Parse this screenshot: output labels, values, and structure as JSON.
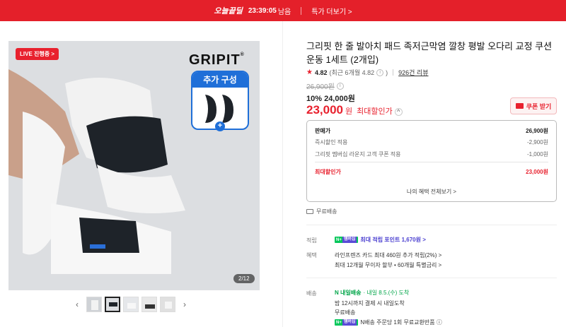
{
  "banner": {
    "brand": "오늘끝딜",
    "timer": "23:39:05",
    "remain": "남음",
    "more": "특가 더보기 >"
  },
  "gallery": {
    "live_badge": "LIVE 진행중 >",
    "brand_logo": "GRIPIT",
    "add_card_title": "추가 구성",
    "page_indicator": "2/12"
  },
  "product": {
    "title": "그리핏 한 줄 발아치 패드 족저근막염 깔창 평발 오다리 교정 쿠션 운동 1세트 (2개입)",
    "rating_score": "4.82",
    "rating_detail": "(최근 6개월 4.82",
    "rating_close": ")",
    "reviews": "926건 리뷰",
    "original_price": "26,900원",
    "discount_line": "10% 24,000원",
    "final_price": "23,000",
    "final_unit": "원",
    "final_label": "최대할인가",
    "coupon_button": "쿠폰 받기"
  },
  "price_box": {
    "rows": [
      {
        "label": "판매가",
        "value": "26,900원"
      },
      {
        "label": "즉시할인 적용",
        "value": "-2,900원"
      },
      {
        "label": "그리핏 멤버십 라운지 고객 쿠폰 적용",
        "value": "-1,000원"
      },
      {
        "label": "최대할인가",
        "value": "23,000원"
      }
    ],
    "more_link": "나의 혜택 전체보기 >"
  },
  "shipping_free": "무료배송",
  "points": {
    "label": "적립",
    "badge_n": "N+",
    "badge_member": "멤버십",
    "text": "최대 적립 포인트 1,670원 >"
  },
  "benefits": {
    "label": "혜택",
    "line1": "라인프렌즈 카드 최대 460원 추가 적립(2%) >",
    "line2": "최대 12개월 무이자 할부 • 60개월 특별금리 >"
  },
  "delivery": {
    "label": "배송",
    "badge": "N 내일배송",
    "arrival": "· 내일 8.5.(수) 도착",
    "cutoff": "밤 12시까지 결제 시 내일도착",
    "free": "무료배송",
    "badge_n": "N+",
    "badge_member": "멤버십",
    "return_text": "N배송 주문당 1회 무료교환반품 ⓘ"
  },
  "colors": {
    "accent_red": "#e8212e",
    "naver_green": "#03c75a",
    "member_purple": "#4a3fd0",
    "gripit_blue": "#1f6fd8"
  }
}
